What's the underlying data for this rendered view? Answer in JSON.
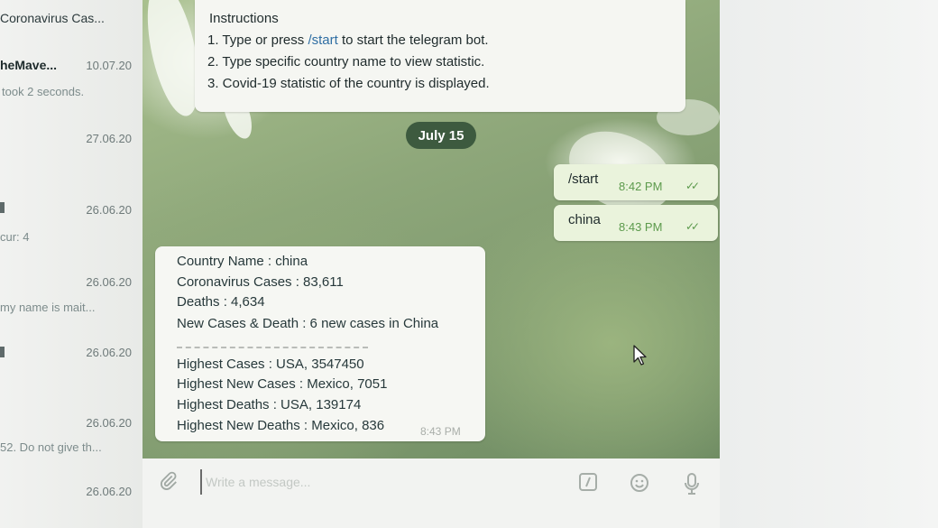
{
  "chat_list": [
    {
      "name": "Coronavirus Cas...",
      "name_bold": false,
      "date": "",
      "preview": ""
    },
    {
      "name": "heMave...",
      "name_bold": true,
      "date": "10.07.20",
      "preview": "took 2 seconds."
    },
    {
      "name": "",
      "name_bold": false,
      "date": "27.06.20",
      "preview": ""
    },
    {
      "name": "",
      "name_bold": false,
      "date": "26.06.20",
      "preview": "cur: 4"
    },
    {
      "name": "",
      "name_bold": false,
      "date": "26.06.20",
      "preview": "my name is mait..."
    },
    {
      "name": "",
      "name_bold": false,
      "date": "26.06.20",
      "preview": ""
    },
    {
      "name": "",
      "name_bold": false,
      "date": "26.06.20",
      "preview": "52. Do not give th..."
    },
    {
      "name": "",
      "name_bold": false,
      "date": "26.06.20",
      "preview": ""
    }
  ],
  "instructions": {
    "title": "Instructions",
    "step1_prefix": "1. Type or press ",
    "step1_command": "/start",
    "step1_suffix": " to start the telegram bot.",
    "step2": "2. Type specific country name to view statistic.",
    "step3": "3. Covid-19 statistic of the country is displayed."
  },
  "date_badge": "July 15",
  "outgoing": [
    {
      "text": "/start",
      "time": "8:42 PM"
    },
    {
      "text": "china",
      "time": "8:43 PM"
    }
  ],
  "reply": {
    "country": "Country Name : china",
    "cases": "Coronavirus Cases : 83,611",
    "deaths": "Deaths : 4,634",
    "new": "New Cases & Death : 6 new cases in China",
    "highest_cases": "Highest Cases : USA, 3547450",
    "highest_new_cases": "Highest New Cases : Mexico, 7051",
    "highest_deaths": "Highest Deaths : USA, 139174",
    "highest_new_deaths": "Highest New Deaths : Mexico, 836",
    "time": "8:43 PM"
  },
  "input": {
    "placeholder": "Write a message..."
  },
  "icons": {
    "attach": "paperclip-icon",
    "commands": "slash-commands-icon",
    "emoji": "emoji-icon",
    "mic": "microphone-icon",
    "read_receipt": "double-check-icon"
  },
  "colors": {
    "outgoing_bubble": "#eaf3dc",
    "incoming_bubble": "#f6f7f3",
    "date_badge": "#3d5a3f",
    "command_link": "#2f6ea3",
    "time_green": "#5c9a4c"
  }
}
